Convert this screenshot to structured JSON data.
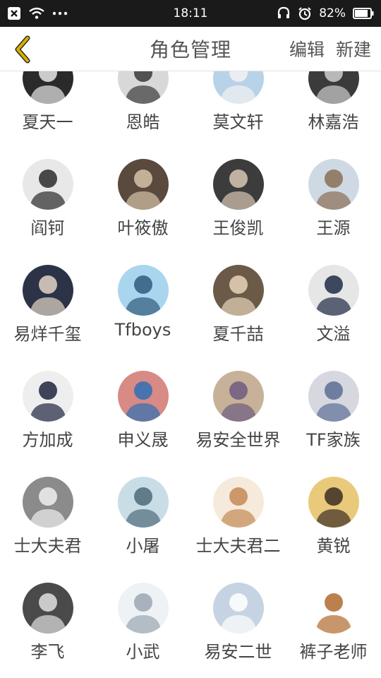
{
  "status_bar": {
    "time": "18:11",
    "battery": "82%",
    "icons": [
      "close-box-icon",
      "wifi-icon",
      "more-dots-icon",
      "headset-icon",
      "alarm-icon",
      "battery-icon"
    ]
  },
  "header": {
    "title": "角色管理",
    "edit_label": "编辑",
    "new_label": "新建",
    "back_icon": "chevron-left-icon",
    "accent_color": "#d6b100"
  },
  "roles": [
    {
      "name": "夏天一",
      "bg": "#2a2a2a",
      "fg": "#e8e8e8"
    },
    {
      "name": "恩皓",
      "bg": "#d8d8d8",
      "fg": "#3a3a3a"
    },
    {
      "name": "莫文轩",
      "bg": "#b8d2e8",
      "fg": "#f2f2f2"
    },
    {
      "name": "林嘉浩",
      "bg": "#3b3b3b",
      "fg": "#cfcfcf"
    },
    {
      "name": "阎钶",
      "bg": "#e8e8e8",
      "fg": "#2b2b2b"
    },
    {
      "name": "叶筱傲",
      "bg": "#5a4a3e",
      "fg": "#d6c2a8"
    },
    {
      "name": "王俊凯",
      "bg": "#3c3c3c",
      "fg": "#d8c6b3"
    },
    {
      "name": "王源",
      "bg": "#cfd9e3",
      "fg": "#8a6e55"
    },
    {
      "name": "易烊千玺",
      "bg": "#2c3346",
      "fg": "#e4d5c6"
    },
    {
      "name": "Tfboys",
      "bg": "#a9d6ee",
      "fg": "#305a7a"
    },
    {
      "name": "夏千喆",
      "bg": "#6a5a47",
      "fg": "#e7d4b9"
    },
    {
      "name": "文溢",
      "bg": "#e6e6e6",
      "fg": "#1f2a44"
    },
    {
      "name": "方加成",
      "bg": "#eeeeee",
      "fg": "#1e2540"
    },
    {
      "name": "申义晟",
      "bg": "#d88a84",
      "fg": "#2f6fb5"
    },
    {
      "name": "易安全世界",
      "bg": "#c7b299",
      "fg": "#6d5b80"
    },
    {
      "name": "TF家族",
      "bg": "#d7d7df",
      "fg": "#5c6f96"
    },
    {
      "name": "士大夫君",
      "bg": "#8b8b8b",
      "fg": "#f0f0f0"
    },
    {
      "name": "小屠",
      "bg": "#c9dde6",
      "fg": "#4e6b7a"
    },
    {
      "name": "士大夫君二",
      "bg": "#f6eadc",
      "fg": "#c48a55"
    },
    {
      "name": "黄锐",
      "bg": "#e9c97a",
      "fg": "#3a2e25"
    },
    {
      "name": "李飞",
      "bg": "#4a4a4a",
      "fg": "#e0e0e0"
    },
    {
      "name": "小武",
      "bg": "#eef2f4",
      "fg": "#9aa7b2"
    },
    {
      "name": "易安二世",
      "bg": "#c6d3e3",
      "fg": "#ffffff"
    },
    {
      "name": "裤子老师",
      "bg": "#ffffff",
      "fg": "#b06a2e"
    }
  ]
}
